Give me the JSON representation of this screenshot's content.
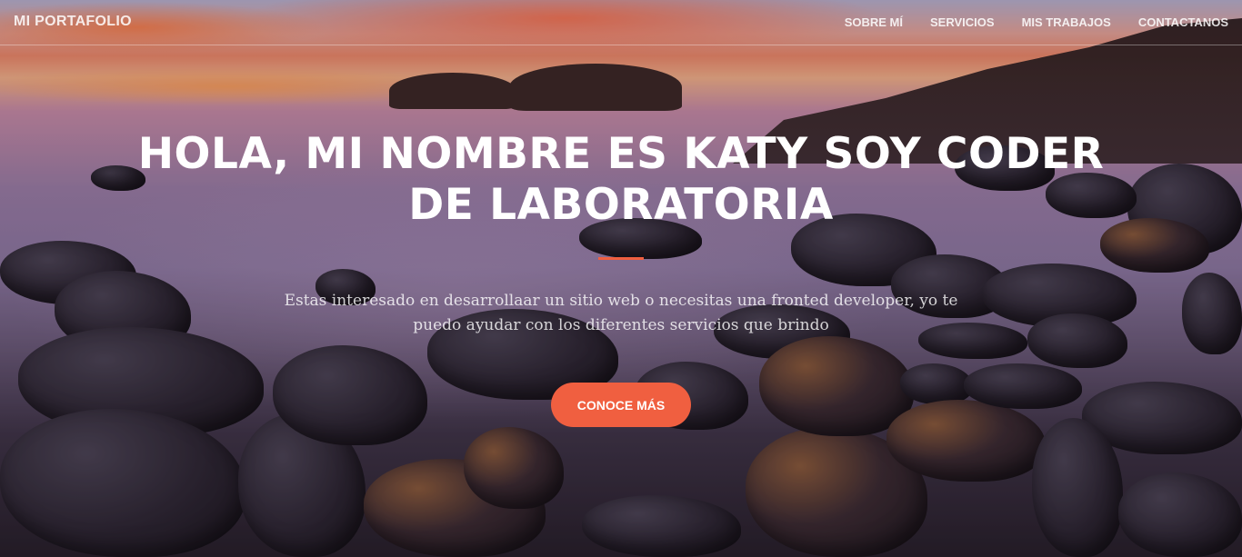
{
  "navbar": {
    "brand": "MI PORTAFOLIO",
    "links": [
      {
        "label": "SOBRE MÍ"
      },
      {
        "label": "SERVICIOS"
      },
      {
        "label": "MIS TRABAJOS"
      },
      {
        "label": "CONTACTANOS"
      }
    ]
  },
  "hero": {
    "headline_line1": "HOLA, MI NOMBRE ES KATY SOY CODER",
    "headline_line2": "DE LABORATORIA",
    "lead_line1": "Estas interesado en desarrollaar un sitio web o necesitas una fronted developer, yo te",
    "lead_line2": "puedo ayudar con los diferentes servicios que brindo",
    "cta_label": "CONOCE MÁS",
    "background": "sunset rocky coastline"
  },
  "colors": {
    "accent": "#f05f40",
    "text": "#ffffff"
  }
}
